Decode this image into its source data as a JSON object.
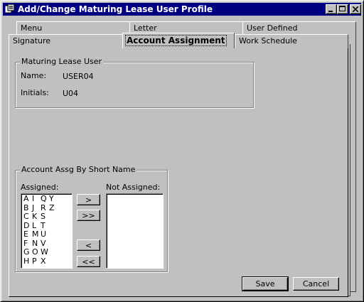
{
  "window": {
    "title": "Add/Change Maturing Lease User Profile",
    "icon": "app-icon",
    "controls": [
      "minimize-icon",
      "maximize-icon",
      "close-icon"
    ]
  },
  "tabs": {
    "row_back": [
      {
        "label": "Menu"
      },
      {
        "label": "Letter"
      },
      {
        "label": "User Defined"
      }
    ],
    "row_front": [
      {
        "label": "Signature"
      },
      {
        "label": "Account Assignment",
        "active": true
      },
      {
        "label": "Work Schedule"
      }
    ]
  },
  "user_group": {
    "legend": "Maturing Lease User",
    "name_label": "Name:",
    "name_value": "USER04",
    "initials_label": "Initials:",
    "initials_value": "U04"
  },
  "account_group": {
    "legend": "Account Assg By Short Name",
    "assigned_label": "Assigned:",
    "not_assigned_label": "Not Assigned:",
    "assigned_rows": [
      [
        "A",
        "I",
        "Q",
        "Y"
      ],
      [
        "B",
        "J",
        "R",
        "Z"
      ],
      [
        "C",
        "K",
        "S",
        ""
      ],
      [
        "D",
        "L",
        "T",
        ""
      ],
      [
        "E",
        "M",
        "U",
        ""
      ],
      [
        "F",
        "N",
        "V",
        ""
      ],
      [
        "G",
        "O",
        "W",
        ""
      ],
      [
        "H",
        "P",
        "X",
        ""
      ]
    ],
    "not_assigned_rows": [],
    "move_right": ">",
    "move_all_right": ">>",
    "move_left": "<",
    "move_all_left": "<<"
  },
  "footer": {
    "save": "Save",
    "cancel": "Cancel"
  },
  "colors": {
    "titlebar": "#000080",
    "face": "#c0c0c0"
  }
}
